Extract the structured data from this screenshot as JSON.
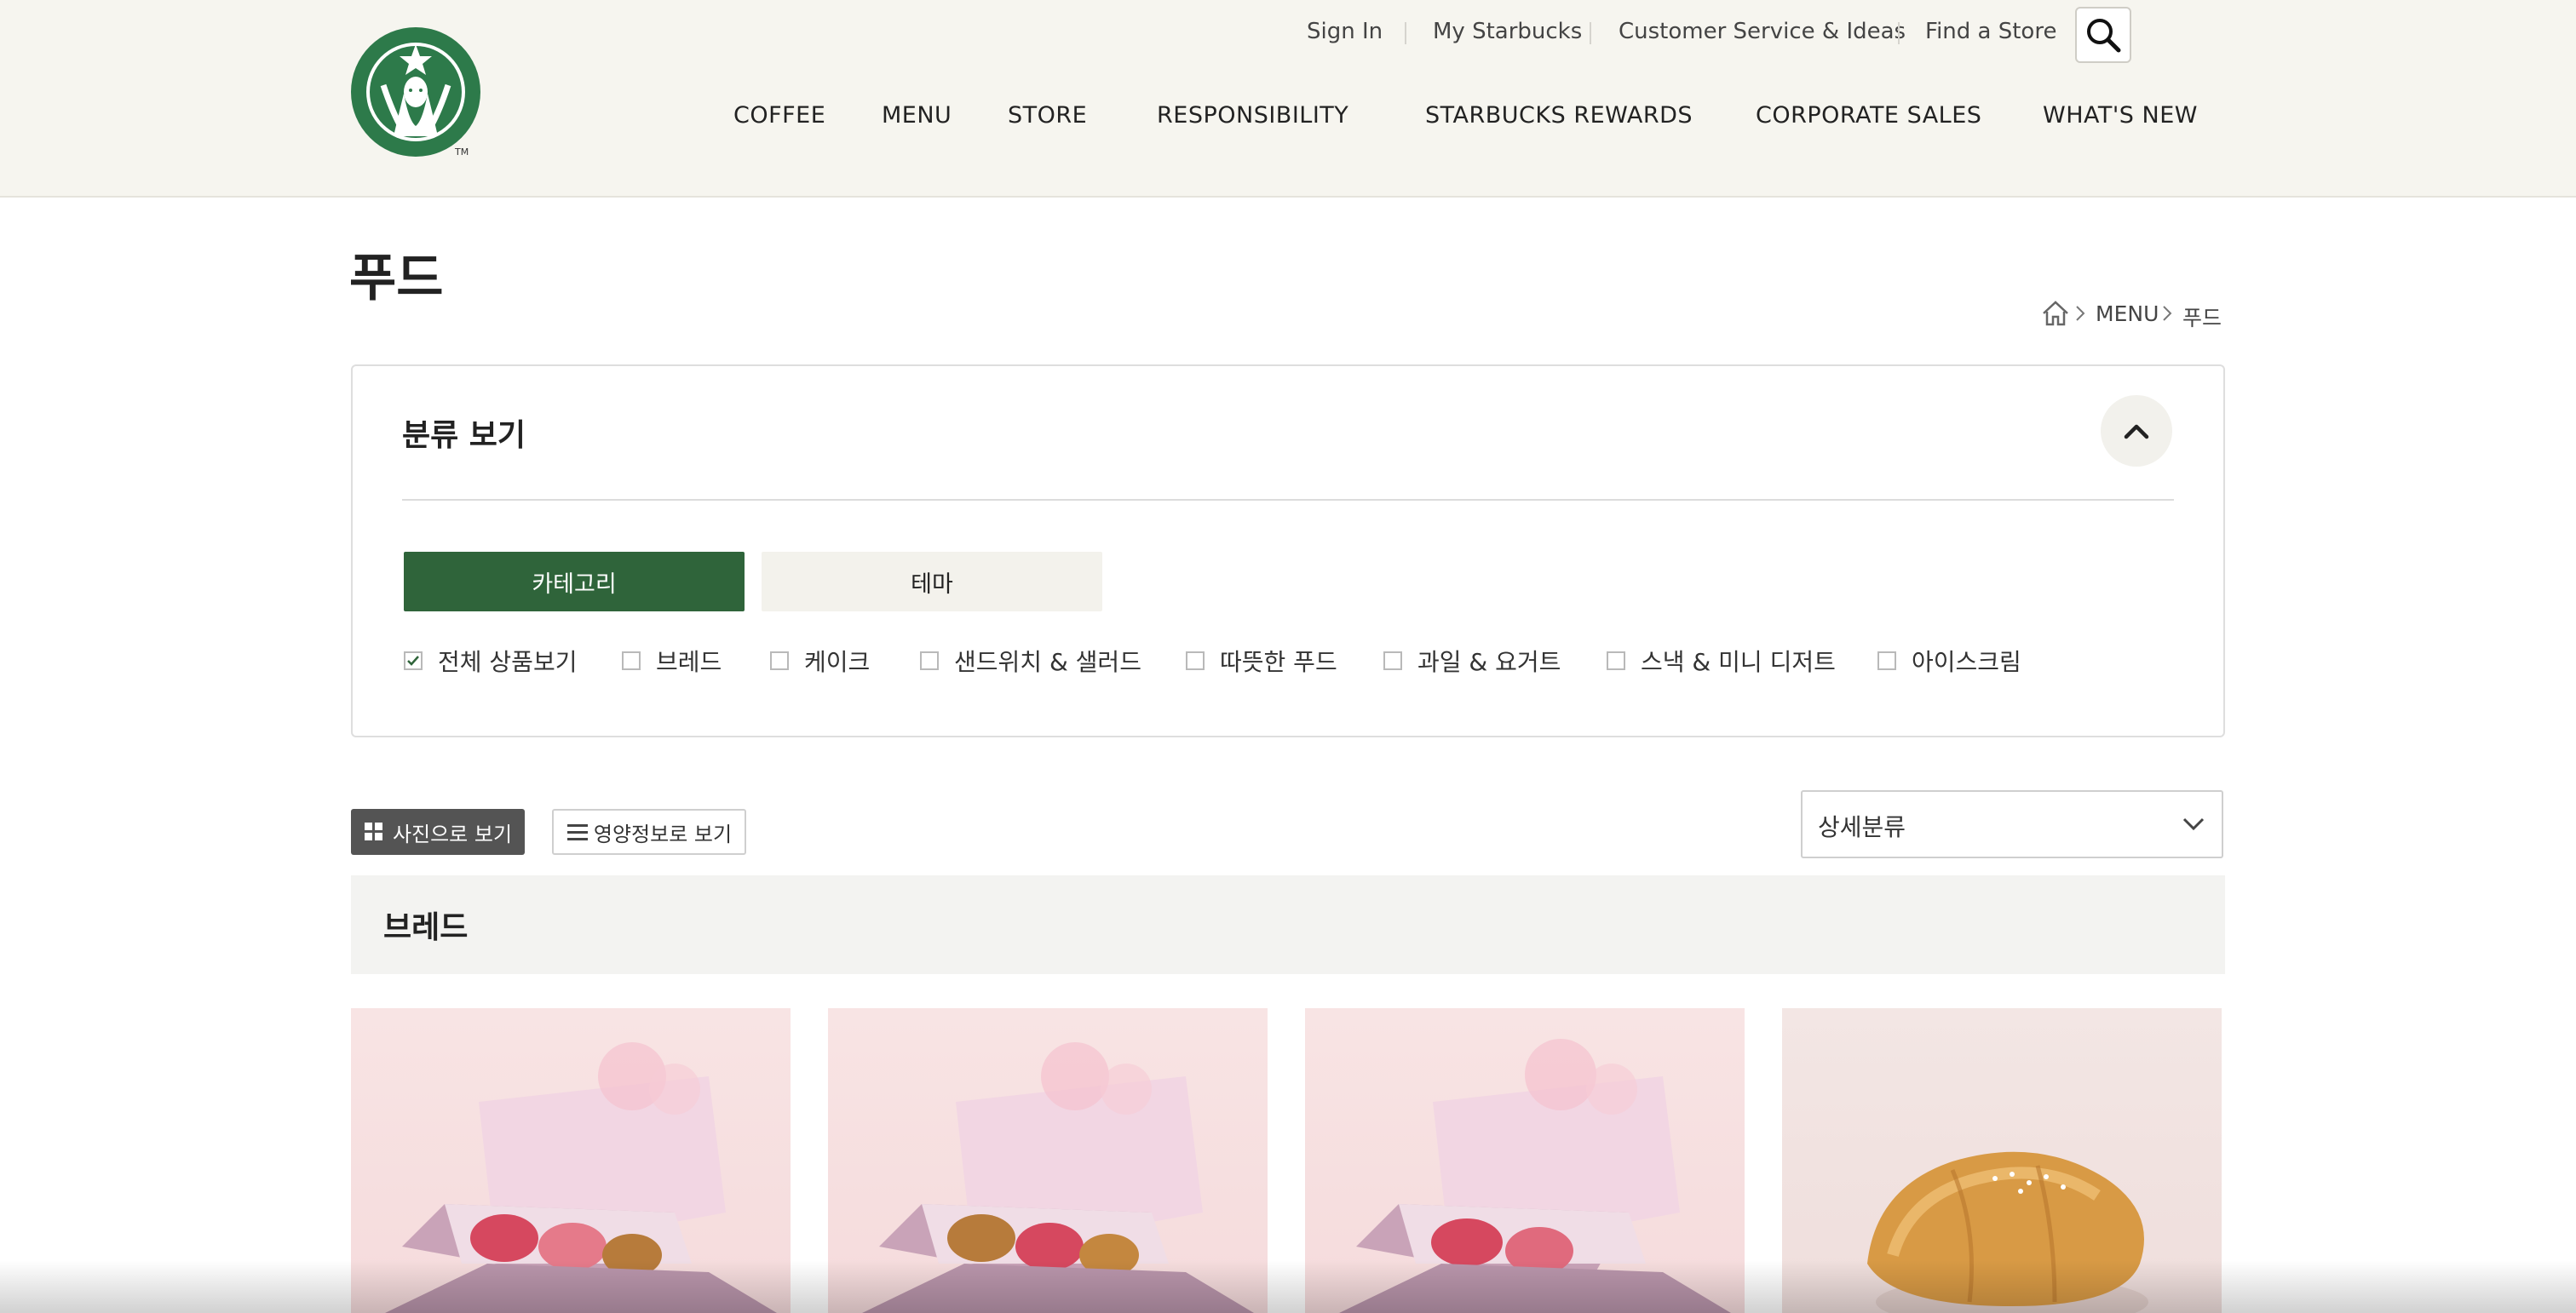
{
  "header": {
    "util_links": [
      "Sign In",
      "My Starbucks",
      "Customer Service & Ideas",
      "Find a Store"
    ],
    "nav": [
      "COFFEE",
      "MENU",
      "STORE",
      "RESPONSIBILITY",
      "STARBUCKS REWARDS",
      "CORPORATE SALES",
      "WHAT'S NEW"
    ],
    "logo_icon": "starbucks-siren-logo",
    "search_icon": "search-icon"
  },
  "page": {
    "title": "푸드",
    "breadcrumb": [
      "MENU",
      "푸드"
    ],
    "home_icon": "home-icon"
  },
  "filter": {
    "title": "분류 보기",
    "tabs": [
      "카테고리",
      "테마"
    ],
    "active_tab": "카테고리",
    "categories": [
      {
        "label": "전체 상품보기",
        "checked": true
      },
      {
        "label": "브레드",
        "checked": false
      },
      {
        "label": "케이크",
        "checked": false
      },
      {
        "label": "샌드위치 & 샐러드",
        "checked": false
      },
      {
        "label": "따뜻한 푸드",
        "checked": false
      },
      {
        "label": "과일 & 요거트",
        "checked": false
      },
      {
        "label": "스낵 & 미니 디저트",
        "checked": false
      },
      {
        "label": "아이스크림",
        "checked": false
      }
    ]
  },
  "view": {
    "photo_label": "사진으로 보기",
    "nutrition_label": "영양정보로 보기",
    "detail_select": "상세분류"
  },
  "section": {
    "title": "브레드"
  },
  "colors": {
    "brand_green": "#2f643a",
    "header_bg": "#f6f5ef"
  }
}
